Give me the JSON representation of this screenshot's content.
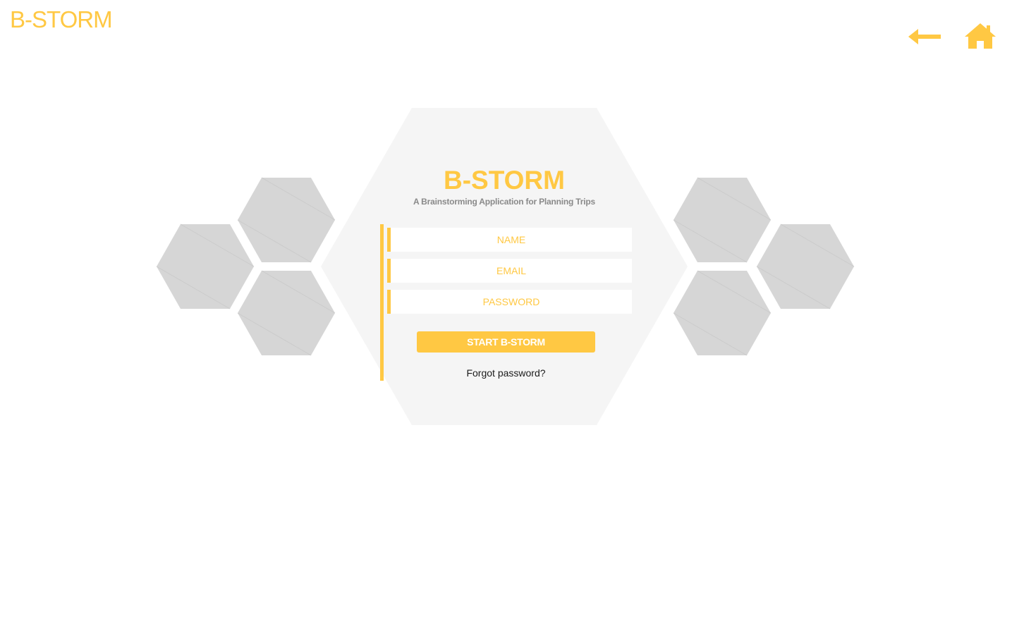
{
  "header": {
    "logo_text": "B-STORM",
    "back_icon": "arrow-left-icon",
    "home_icon": "home-icon"
  },
  "hero": {
    "title": "B-STORM",
    "subtitle": "A Brainstorming Application for Planning Trips"
  },
  "form": {
    "name_placeholder": "NAME",
    "email_placeholder": "EMAIL",
    "password_placeholder": "PASSWORD",
    "submit_label": "START B-STORM",
    "forgot_label": "Forgot password?"
  },
  "colors": {
    "accent": "#ffc843",
    "hex_panel": "#f5f5f5",
    "hex_tile": "#d6d6d6",
    "subtitle": "#8a8a8a"
  }
}
